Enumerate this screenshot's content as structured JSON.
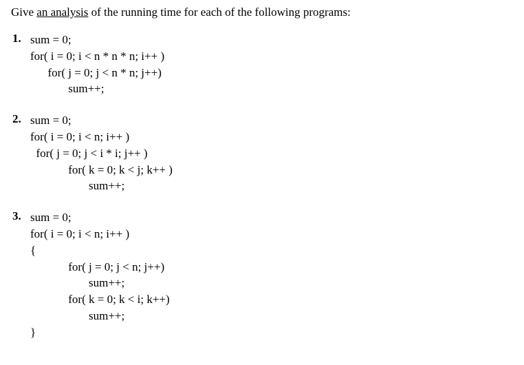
{
  "intro": {
    "pre": "Give ",
    "underlined": "an analysis",
    "post": " of the running time for each of the following programs:"
  },
  "items": [
    {
      "num": "1.",
      "code": "sum = 0;\nfor( i = 0; i < n * n * n; i++ )\n      for( j = 0; j < n * n; j++)\n             sum++;"
    },
    {
      "num": "2.",
      "code": "sum = 0;\nfor( i = 0; i < n; i++ )\n  for( j = 0; j < i * i; j++ )\n             for( k = 0; k < j; k++ )\n                    sum++;"
    },
    {
      "num": "3.",
      "code": "sum = 0;\nfor( i = 0; i < n; i++ )\n{\n             for( j = 0; j < n; j++)\n                    sum++;\n             for( k = 0; k < i; k++)\n                    sum++;\n}"
    }
  ]
}
